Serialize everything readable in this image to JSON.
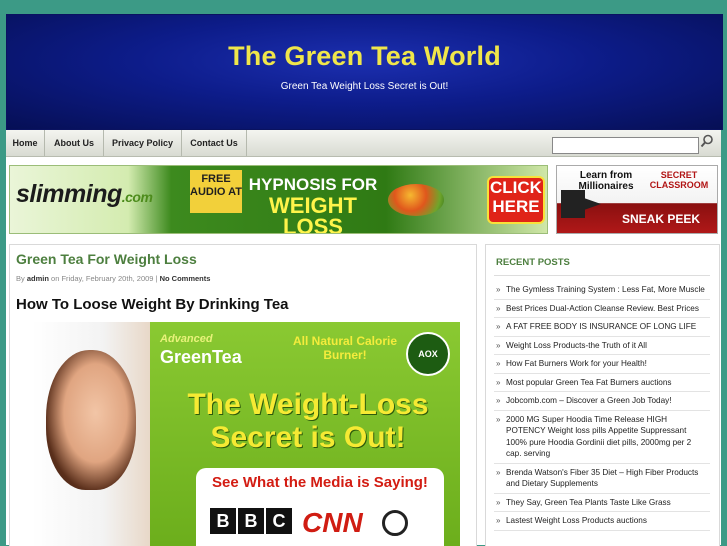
{
  "header": {
    "title": "The Green Tea World",
    "description": "Green Tea Weight Loss Secret is Out!"
  },
  "nav": {
    "items": [
      "Home",
      "About Us",
      "Privacy Policy",
      "Contact Us"
    ],
    "search_placeholder": "",
    "search_icon": "magnifier-icon"
  },
  "banners": {
    "main": {
      "logo": "slimming",
      "logo_suffix": ".com",
      "free_audio": "FREE AUDIO AT",
      "line1": "HYPNOSIS FOR",
      "line2": "WEIGHT LOSS",
      "cta": "CLICK HERE"
    },
    "side": {
      "learn": "Learn from Millionaires",
      "secret": "SECRET CLASSROOM",
      "cta": "SNEAK PEEK"
    }
  },
  "post": {
    "title": "Green Tea For Weight Loss",
    "meta_by": "By",
    "meta_author": "admin",
    "meta_on": "on Friday, February 20th, 2009 |",
    "meta_comments": "No Comments",
    "heading": "How To Loose Weight By Drinking Tea",
    "ad": {
      "brand_top": "Advanced",
      "brand": "GreenTea",
      "tagline": "All Natural Calorie Burner!",
      "badge": "AOX",
      "headline": "The Weight-Loss Secret is Out!",
      "media_line": "See What the Media is Saying!",
      "bbc": [
        "B",
        "B",
        "C"
      ],
      "cnn": "CNN"
    }
  },
  "sidebar": {
    "title": "RECENT POSTS",
    "posts": [
      "The Gymless Training System : Less Fat, More Muscle",
      "Best Prices Dual-Action Cleanse Review. Best Prices",
      "A FAT FREE BODY IS INSURANCE OF LONG LIFE",
      "Weight Loss Products-the Truth of it All",
      "How Fat Burners Work for your Health!",
      "Most popular Green Tea Fat Burners auctions",
      "Jobcomb.com – Discover a Green Job Today!",
      "2000 MG Super Hoodia Time Release HIGH POTENCY Weight loss pills Appetite Suppressant 100% pure Hoodia Gordinii diet pills, 2000mg per 2 cap. serving",
      "Brenda Watson's Fiber 35 Diet – High Fiber Products and Dietary Supplements",
      "They Say, Green Tea Plants Taste Like Grass",
      "Lastest Weight Loss Products auctions"
    ]
  },
  "colors": {
    "accent_green": "#4d7f3f",
    "title_yellow": "#f0e64a",
    "header_blue": "#0d1c8a",
    "frame_teal": "#3c9a86"
  }
}
